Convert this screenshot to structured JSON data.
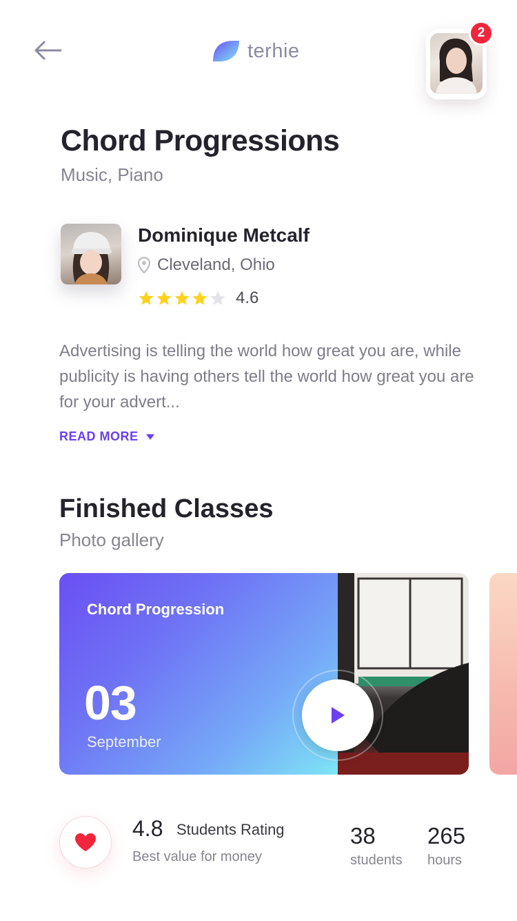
{
  "header": {
    "logo_text": "terhie",
    "notification_count": "2",
    "colors": {
      "logo_gradient_start": "#6a4ff3",
      "logo_gradient_end": "#7fe5f6",
      "badge": "#f1263c"
    }
  },
  "course": {
    "title": "Chord Progressions",
    "subtitle": "Music, Piano"
  },
  "instructor": {
    "name": "Dominique Metcalf",
    "location": "Cleveland, Ohio",
    "rating": "4.6",
    "stars_filled": 4,
    "stars_total": 5
  },
  "description": {
    "text": "Advertising is telling the world how great you are, while publicity is having others tell the world how great you are for your advert...",
    "read_more": "READ MORE"
  },
  "finished_classes": {
    "title": "Finished Classes",
    "subtitle": "Photo gallery",
    "cards": [
      {
        "title": "Chord Progression",
        "day": "03",
        "month": "September"
      }
    ]
  },
  "stats": {
    "rating_value": "4.8",
    "rating_label": "Students Rating",
    "rating_caption": "Best value for money",
    "students_count": "38",
    "students_label": "students",
    "hours_count": "265",
    "hours_label": "hours"
  },
  "accent_color": "#6b3ff2",
  "star_color": "#ffd21f"
}
